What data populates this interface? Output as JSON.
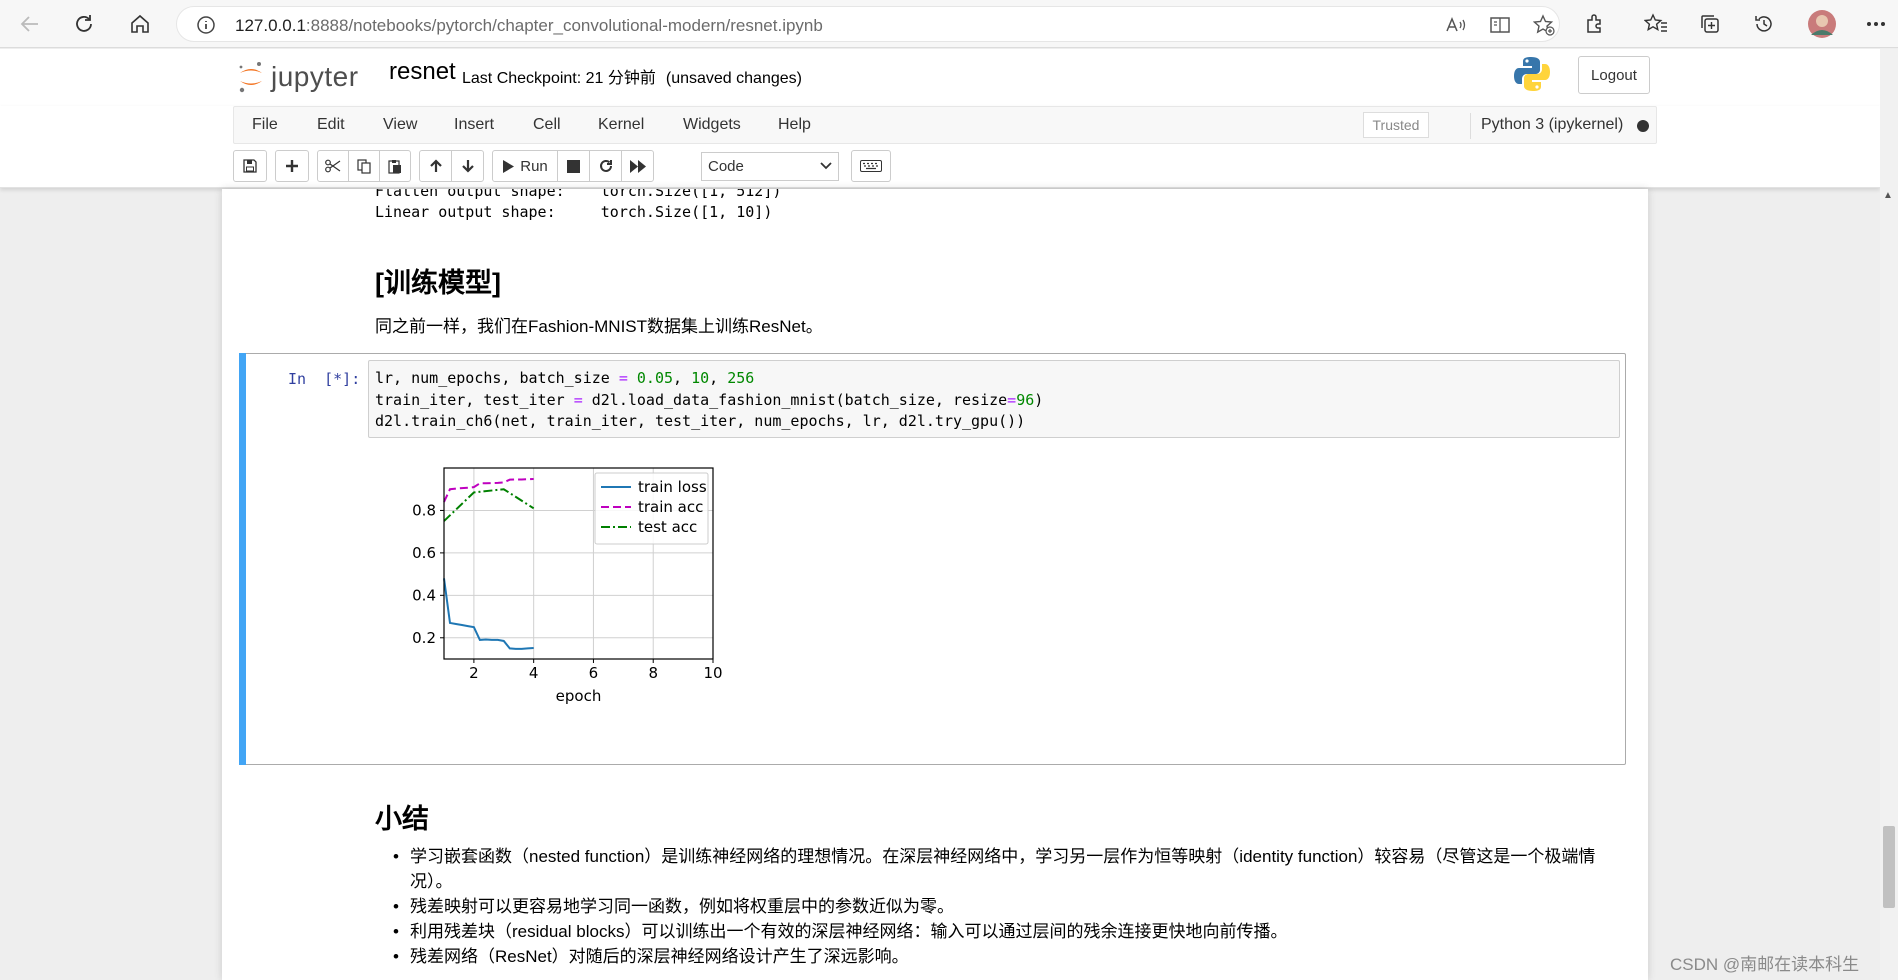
{
  "browser": {
    "url_host": "127.0.0.1",
    "url_rest": ":8888/notebooks/pytorch/chapter_convolutional-modern/resnet.ipynb"
  },
  "header": {
    "logo_text": "jupyter",
    "notebook_name": "resnet",
    "checkpoint": "Last Checkpoint: 21 分钟前",
    "unsaved": "(unsaved changes)",
    "logout": "Logout"
  },
  "menu": {
    "items": [
      "File",
      "Edit",
      "View",
      "Insert",
      "Cell",
      "Kernel",
      "Widgets",
      "Help"
    ],
    "trusted": "Trusted",
    "kernel": "Python 3 (ipykernel)"
  },
  "toolbar": {
    "run": "Run",
    "cell_type": "Code"
  },
  "notebook": {
    "prev_output_line1": "Flatten output shape:    torch.Size([1, 512])",
    "prev_output_line2": "Linear output shape:     torch.Size([1, 10])",
    "heading": "[训练模型]",
    "paragraph": "同之前一样，我们在Fashion-MNIST数据集上训练ResNet。",
    "cell_prompt": "In  [*]:",
    "code_line1": "lr, num_epochs, batch_size = 0.05, 10, 256",
    "code_line2": "train_iter, test_iter = d2l.load_data_fashion_mnist(batch_size, resize=96)",
    "code_line3": "d2l.train_ch6(net, train_iter, test_iter, num_epochs, lr, d2l.try_gpu())",
    "summary_heading": "小结",
    "summary_items": [
      "学习嵌套函数（nested function）是训练神经网络的理想情况。在深层神经网络中，学习另一层作为恒等映射（identity function）较容易（尽管这是一个极端情况）。",
      "残差映射可以更容易地学习同一函数，例如将权重层中的参数近似为零。",
      "利用残差块（residual blocks）可以训练出一个有效的深层神经网络：输入可以通过层间的残余连接更快地向前传播。",
      "残差网络（ResNet）对随后的深层神经网络设计产生了深远影响。"
    ]
  },
  "watermark": "CSDN @南邮在读本科生",
  "chart_data": {
    "type": "line",
    "xlabel": "epoch",
    "ylabel": "",
    "xlim": [
      1,
      10
    ],
    "ylim": [
      0.1,
      1.0
    ],
    "xticks": [
      2,
      4,
      6,
      8,
      10
    ],
    "yticks": [
      0.2,
      0.4,
      0.6,
      0.8
    ],
    "grid": true,
    "legend": "top-right",
    "series": [
      {
        "name": "train loss",
        "color": "#1f77b4",
        "style": "solid",
        "x": [
          1.0,
          1.2,
          1.4,
          1.6,
          1.8,
          2.0,
          2.2,
          2.4,
          2.6,
          2.8,
          3.0,
          3.2,
          3.4,
          3.6,
          3.8,
          4.0
        ],
        "y": [
          0.48,
          0.27,
          0.265,
          0.26,
          0.255,
          0.25,
          0.19,
          0.192,
          0.19,
          0.19,
          0.185,
          0.15,
          0.148,
          0.148,
          0.15,
          0.152
        ]
      },
      {
        "name": "train acc",
        "color": "#bf00bf",
        "style": "dashed",
        "x": [
          1.0,
          1.2,
          1.4,
          1.6,
          1.8,
          2.0,
          2.2,
          2.4,
          2.6,
          2.8,
          3.0,
          3.2,
          3.4,
          3.6,
          3.8,
          4.0
        ],
        "y": [
          0.84,
          0.9,
          0.903,
          0.905,
          0.907,
          0.91,
          0.928,
          0.928,
          0.929,
          0.93,
          0.932,
          0.945,
          0.946,
          0.946,
          0.947,
          0.948
        ]
      },
      {
        "name": "test acc",
        "color": "#008000",
        "style": "dashdot",
        "x": [
          1.0,
          2.0,
          3.0,
          4.0
        ],
        "y": [
          0.75,
          0.885,
          0.9,
          0.81
        ]
      }
    ]
  }
}
